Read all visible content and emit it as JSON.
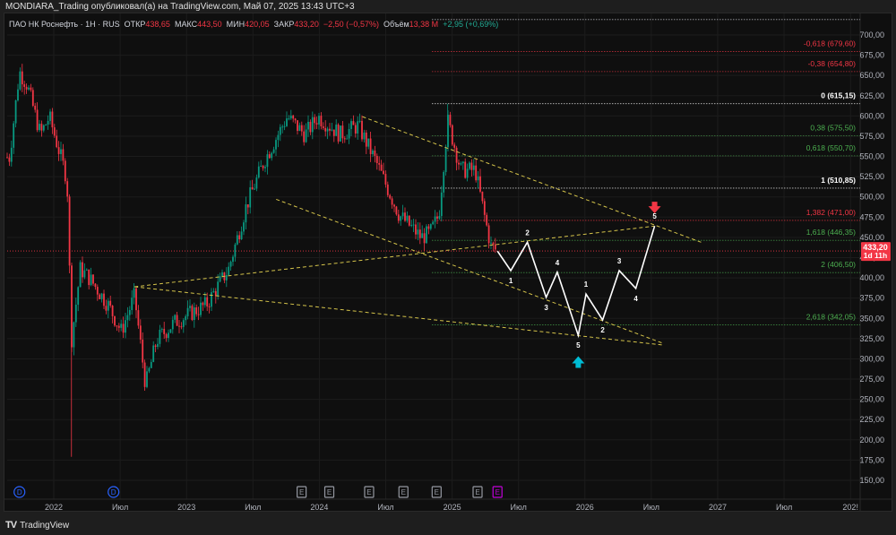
{
  "header": {
    "title": "MONDIARA_Trading опубликовал(а) на TradingView.com, Май 07, 2025 13:43 UTC+3"
  },
  "legend": {
    "symbol": "ПАО НК Роснефть · 1Н · RUS",
    "open_label": "ОТКР",
    "open": "438,65",
    "high_label": "МАКС",
    "high": "443,50",
    "low_label": "МИН",
    "low": "420,05",
    "close_label": "ЗАКР",
    "close": "433,20",
    "change": "−2,50 (−0,57%)",
    "volume_label": "Объём",
    "volume": "13,38 M",
    "ext_change": "+2,95 (+0,69%)"
  },
  "price_axis": {
    "ticks": [
      "700,00",
      "675,00",
      "650,00",
      "625,00",
      "600,00",
      "575,00",
      "550,00",
      "525,00",
      "500,00",
      "475,00",
      "450,00",
      "425,00",
      "400,00",
      "375,00",
      "350,00",
      "325,00",
      "300,00",
      "275,00",
      "250,00",
      "225,00",
      "200,00",
      "175,00",
      "150,00"
    ],
    "values": [
      700,
      675,
      650,
      625,
      600,
      575,
      550,
      525,
      500,
      475,
      450,
      425,
      400,
      375,
      350,
      325,
      300,
      275,
      250,
      225,
      200,
      175,
      150
    ],
    "current_price": "433,20",
    "current_value": 433.2,
    "countdown": "1d 11h"
  },
  "time_axis": {
    "labels": [
      "2022",
      "Июл",
      "2023",
      "Июл",
      "2024",
      "Июл",
      "2025",
      "Июл",
      "2026",
      "Июл",
      "2027",
      "Июл",
      "202!"
    ],
    "months": [
      0,
      6,
      12,
      18,
      24,
      30,
      36,
      42,
      48,
      54,
      60,
      66,
      72
    ]
  },
  "fib_levels": [
    {
      "label": "",
      "price": 719,
      "color": "#d1d4dc"
    },
    {
      "label": "-0,618 (679,60)",
      "price": 679.6,
      "color": "#f23645"
    },
    {
      "label": "-0,38 (654,80)",
      "price": 654.8,
      "color": "#f23645"
    },
    {
      "label": "0 (615,15)",
      "price": 615.15,
      "color": "#ffffff"
    },
    {
      "label": "0,38 (575,50)",
      "price": 575.5,
      "color": "#4caf50"
    },
    {
      "label": "0,618 (550,70)",
      "price": 550.7,
      "color": "#4caf50"
    },
    {
      "label": "1 (510,85)",
      "price": 510.85,
      "color": "#ffffff"
    },
    {
      "label": "1,382 (471,00)",
      "price": 471.0,
      "color": "#f23645"
    },
    {
      "label": "1,618 (446,35)",
      "price": 446.35,
      "color": "#4caf50"
    },
    {
      "label": "2 (406,50)",
      "price": 406.5,
      "color": "#4caf50"
    },
    {
      "label": "2,618 (342,05)",
      "price": 342.05,
      "color": "#4caf50"
    }
  ],
  "price_path": [
    [
      -4.0,
      549
    ],
    [
      -3.1,
      655
    ],
    [
      -2.4,
      638
    ],
    [
      -1.2,
      577
    ],
    [
      -0.4,
      599
    ],
    [
      1.2,
      522
    ],
    [
      1.6,
      323
    ],
    [
      2.4,
      411
    ],
    [
      3.2,
      400
    ],
    [
      4.9,
      367
    ],
    [
      6.1,
      334
    ],
    [
      7.3,
      378
    ],
    [
      8.3,
      267
    ],
    [
      9.3,
      323
    ],
    [
      10.9,
      345
    ],
    [
      13.8,
      367
    ],
    [
      15.8,
      411
    ],
    [
      17.4,
      489
    ],
    [
      19.0,
      544
    ],
    [
      21.1,
      599
    ],
    [
      22.7,
      577
    ],
    [
      23.9,
      599
    ],
    [
      25.9,
      577
    ],
    [
      27.5,
      588
    ],
    [
      29.1,
      544
    ],
    [
      31.2,
      478
    ],
    [
      33.2,
      450
    ],
    [
      34.0,
      455
    ],
    [
      34.8,
      478
    ],
    [
      35.6,
      594
    ],
    [
      36.8,
      533
    ],
    [
      38.1,
      533
    ],
    [
      38.9,
      478
    ],
    [
      39.5,
      439
    ],
    [
      40.1,
      433
    ]
  ],
  "wave_projection": [
    [
      40.1,
      433
    ],
    [
      41.3,
      409
    ],
    [
      42.8,
      444
    ],
    [
      44.5,
      376
    ],
    [
      45.5,
      407
    ],
    [
      47.4,
      329
    ],
    [
      48.1,
      380
    ],
    [
      49.6,
      348
    ],
    [
      51.1,
      409
    ],
    [
      52.6,
      387
    ],
    [
      54.3,
      464
    ]
  ],
  "wave_labels": [
    "1",
    "2",
    "3",
    "4",
    "5",
    "1",
    "2",
    "3",
    "4",
    "5"
  ],
  "trendlines": [
    [
      [
        27.9,
        599
      ],
      [
        58.5,
        444
      ]
    ],
    [
      [
        20.1,
        497
      ],
      [
        55.1,
        319
      ]
    ],
    [
      [
        7.3,
        389
      ],
      [
        54.3,
        464
      ]
    ],
    [
      [
        7.3,
        389
      ],
      [
        55.1,
        317
      ]
    ]
  ],
  "arrows": {
    "sell": [
      54.3,
      483
    ],
    "buy": [
      47.4,
      300
    ]
  },
  "events": {
    "dividends": [
      {
        "label": "D",
        "month": -3.1
      },
      {
        "label": "D",
        "month": 5.4
      }
    ],
    "earnings": [
      {
        "label": "E",
        "month": 22.4
      },
      {
        "label": "E",
        "month": 24.9
      },
      {
        "label": "E",
        "month": 28.5
      },
      {
        "label": "E",
        "month": 31.6
      },
      {
        "label": "E",
        "month": 34.6
      },
      {
        "label": "E",
        "month": 38.3
      },
      {
        "label": "E",
        "month": 40.1,
        "upcoming": true
      }
    ]
  },
  "colors": {
    "up": "#089981",
    "down": "#f23645",
    "trend": "#d4c34a",
    "wave": "#ffffff",
    "sell": "#f23645",
    "buy": "#00bcd4"
  },
  "footer": {
    "logo": "TV",
    "brand": "TradingView"
  }
}
